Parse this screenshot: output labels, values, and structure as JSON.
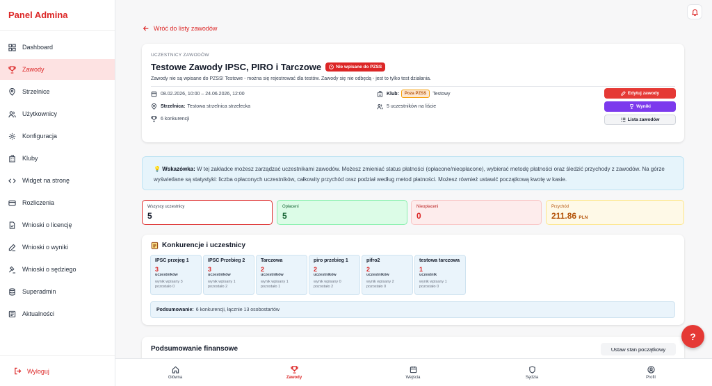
{
  "sidebar": {
    "brand": "Panel Admina",
    "items": [
      {
        "label": "Dashboard",
        "icon": "dashboard-icon"
      },
      {
        "label": "Zawody",
        "icon": "trophy-icon"
      },
      {
        "label": "Strzelnice",
        "icon": "location-pin-icon"
      },
      {
        "label": "Użytkownicy",
        "icon": "users-icon"
      },
      {
        "label": "Konfiguracja",
        "icon": "gear-icon"
      },
      {
        "label": "Kluby",
        "icon": "building-icon"
      },
      {
        "label": "Widget na stronę",
        "icon": "code-icon"
      },
      {
        "label": "Rozliczenia",
        "icon": "credit-card-icon"
      },
      {
        "label": "Wnioski o licencję",
        "icon": "document-check-icon"
      },
      {
        "label": "Wnioski o wyniki",
        "icon": "pencil-icon"
      },
      {
        "label": "Wnioski o sędziego",
        "icon": "gavel-icon"
      },
      {
        "label": "Superadmin",
        "icon": "database-icon"
      },
      {
        "label": "Aktualności",
        "icon": "news-icon"
      }
    ],
    "logout": "Wyloguj"
  },
  "header": {
    "back_link": "Wróć do listy zawodów"
  },
  "competition": {
    "eyebrow": "UCZESTNICY ZAWODÓW",
    "title": "Testowe Zawody IPSC, PIRO i Tarczowe",
    "badge": "Nie wpisane do PZSS",
    "description": "Zawody nie są wpisane do PZSS! Testowe - można się rejestrować dla testów. Zawody się nie odbędą - jest to tylko test działania.",
    "dates": "08.02.2026, 10:00 – 24.06.2026, 12:00",
    "range_label": "Strzelnica:",
    "range_value": "Testowa strzelnica strzelecka",
    "competitions_count": "6 konkurencji",
    "club_label": "Klub:",
    "club_badge": "Poza PZSS",
    "club_name": "Testowy",
    "participants_on_list": "5 uczestników na liście",
    "buttons": {
      "edit": "Edytuj zawody",
      "results": "Wyniki",
      "list": "Lista zawodów"
    }
  },
  "tip": {
    "label": "Wskazówka:",
    "text": "W tej zakładce możesz zarządzać uczestnikami zawodów. Możesz zmieniać status płatności (opłacone/nieopłacone), wybierać metodę płatności oraz śledzić przychody z zawodów. Na górze wyświetlane są statystyki: liczba opłaconych uczestników, całkowity przychód oraz podział według metod płatności. Możesz również ustawić początkową kwotę w kasie."
  },
  "stats": {
    "all": {
      "label": "Wszyscy uczestnicy",
      "value": "5"
    },
    "paid": {
      "label": "Opłaceni",
      "value": "5"
    },
    "unpaid": {
      "label": "Nieopłaceni",
      "value": "0"
    },
    "revenue": {
      "label": "Przychód",
      "value": "211.86",
      "unit": "PLN"
    }
  },
  "competitions_section": {
    "title": "Konkurencje i uczestnicy",
    "cards": [
      {
        "name": "IPSC przejeg 1",
        "count": "3",
        "unit": "uczestników",
        "line1": "wynik wpisany 3",
        "line2": "pozostało 0"
      },
      {
        "name": "IPSC Przebieg 2",
        "count": "3",
        "unit": "uczestników",
        "line1": "wynik wpisany 1",
        "line2": "pozostało 2"
      },
      {
        "name": "Tarczowa",
        "count": "2",
        "unit": "uczestników",
        "line1": "wynik wpisany 1",
        "line2": "pozostało 1"
      },
      {
        "name": "piro przebieg 1",
        "count": "2",
        "unit": "uczestników",
        "line1": "wynik wpisany 0",
        "line2": "pozostało 2"
      },
      {
        "name": "pifro2",
        "count": "2",
        "unit": "uczestników",
        "line1": "wynik wpisany 2",
        "line2": "pozostało 0"
      },
      {
        "name": "testowa tarczowa",
        "count": "1",
        "unit": "uczestnik",
        "line1": "wynik wpisany 1",
        "line2": "pozostało 0"
      }
    ],
    "summary_label": "Podsumowanie:",
    "summary_text": "6 konkurencji, łącznie 13 osobostartów"
  },
  "finance": {
    "title": "Podsumowanie finansowe",
    "button": "Ustaw stan początkowy"
  },
  "help_button": "?",
  "bottom_nav": [
    {
      "label": "Główna",
      "icon": "home-icon"
    },
    {
      "label": "Zawody",
      "icon": "trophy-icon"
    },
    {
      "label": "Wejścia",
      "icon": "calendar-icon"
    },
    {
      "label": "Sędzia",
      "icon": "shield-icon"
    },
    {
      "label": "Profil",
      "icon": "profile-icon"
    }
  ],
  "colors": {
    "accent": "#dc2626",
    "purple": "#7c3aed",
    "active_bg": "#fde2e2",
    "paid": "#166534",
    "revenue": "#b45309"
  }
}
